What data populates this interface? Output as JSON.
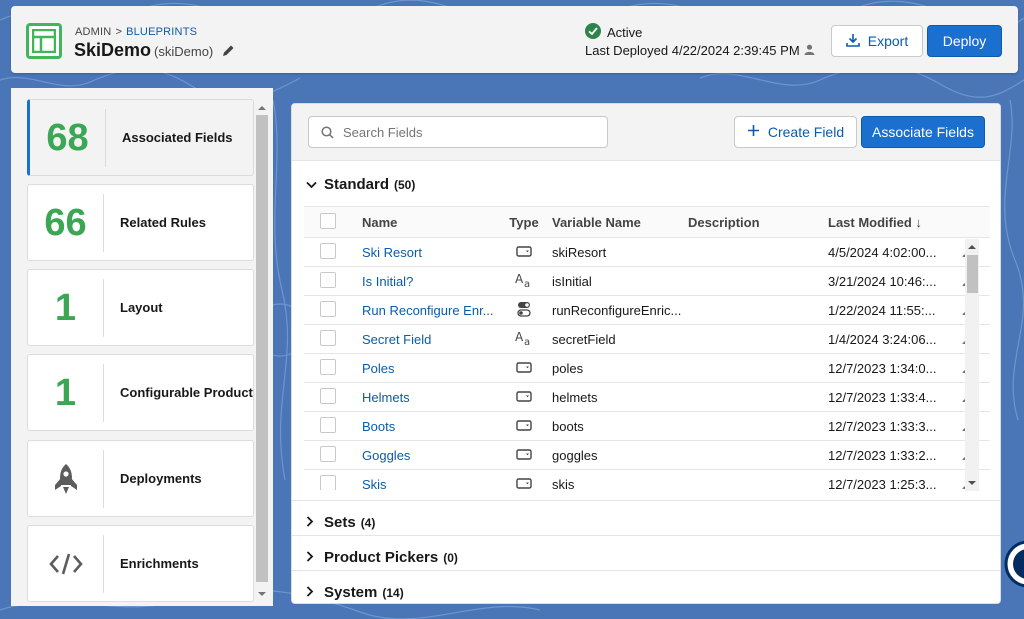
{
  "header": {
    "breadcrumb_root": "ADMIN",
    "breadcrumb_sep": ">",
    "breadcrumb_link": "BLUEPRINTS",
    "title": "SkiDemo",
    "subtitle": "(skiDemo)",
    "status": "Active",
    "last_deployed": "Last Deployed 4/22/2024 2:39:45 PM",
    "export_label": "Export",
    "deploy_label": "Deploy"
  },
  "sidebar": {
    "items": [
      {
        "count": "68",
        "label": "Associated Fields",
        "active": true
      },
      {
        "count": "66",
        "label": "Related Rules"
      },
      {
        "count": "1",
        "label": "Layout"
      },
      {
        "count": "1",
        "label": "Configurable Product"
      },
      {
        "icon": "rocket-icon",
        "label": "Deployments"
      },
      {
        "icon": "code-icon",
        "label": "Enrichments"
      }
    ]
  },
  "toolbar": {
    "search_placeholder": "Search Fields",
    "create_label": "Create Field",
    "associate_label": "Associate Fields"
  },
  "sections": {
    "standard": {
      "name": "Standard",
      "count": "(50)"
    },
    "sets": {
      "name": "Sets",
      "count": "(4)"
    },
    "pickers": {
      "name": "Product Pickers",
      "count": "(0)"
    },
    "system": {
      "name": "System",
      "count": "(14)"
    }
  },
  "table": {
    "columns": {
      "name": "Name",
      "type": "Type",
      "variable": "Variable Name",
      "description": "Description",
      "modified": "Last Modified ↓"
    },
    "rows": [
      {
        "name": "Ski Resort",
        "type": "picklist-icon",
        "variable": "skiResort",
        "modified": "4/5/2024 4:02:00..."
      },
      {
        "name": "Is Initial?",
        "type": "text-icon",
        "variable": "isInitial",
        "modified": "3/21/2024 10:46:..."
      },
      {
        "name": "Run Reconfigure Enr...",
        "type": "toggle-icon",
        "variable": "runReconfigureEnric...",
        "modified": "1/22/2024 11:55:..."
      },
      {
        "name": "Secret Field",
        "type": "text-icon",
        "variable": "secretField",
        "modified": "1/4/2024 3:24:06..."
      },
      {
        "name": "Poles",
        "type": "picklist-icon",
        "variable": "poles",
        "modified": "12/7/2023 1:34:0..."
      },
      {
        "name": "Helmets",
        "type": "picklist-icon",
        "variable": "helmets",
        "modified": "12/7/2023 1:33:4..."
      },
      {
        "name": "Boots",
        "type": "picklist-icon",
        "variable": "boots",
        "modified": "12/7/2023 1:33:3..."
      },
      {
        "name": "Goggles",
        "type": "picklist-icon",
        "variable": "goggles",
        "modified": "12/7/2023 1:33:2..."
      },
      {
        "name": "Skis",
        "type": "picklist-icon",
        "variable": "skis",
        "modified": "12/7/2023 1:25:3..."
      }
    ]
  },
  "colors": {
    "brand": "#1b6fce",
    "link": "#0b5cab",
    "success": "#3ba755",
    "background": "#4a76b8"
  }
}
